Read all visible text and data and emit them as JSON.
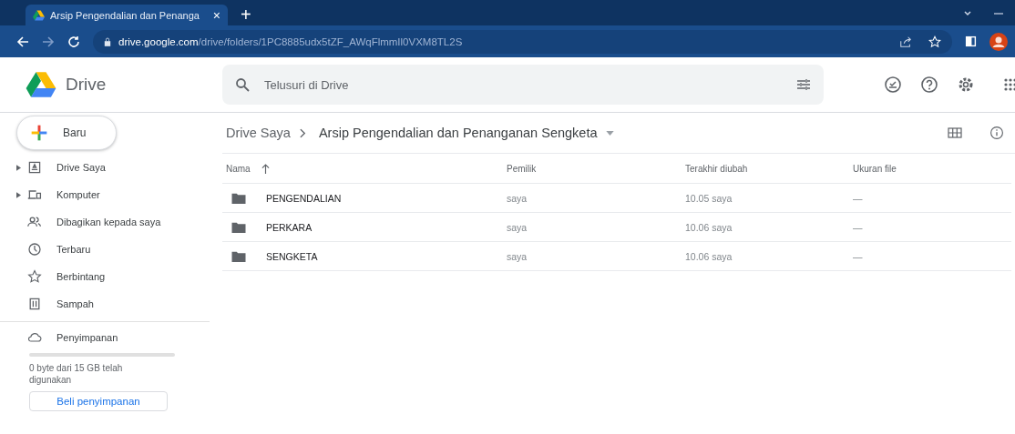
{
  "browser": {
    "tab_title": "Arsip Pengendalian dan Penanga",
    "tab_close": "×",
    "new_tab": "+",
    "url_host": "drive.google.com",
    "url_path": "/drive/folders/1PC8885udx5tZF_AWqFlmmIl0VXM8TL2S"
  },
  "app": {
    "name": "Drive",
    "search": {
      "placeholder": "Telusuri di Drive"
    }
  },
  "new_button": "Baru",
  "sidebar": {
    "items": [
      {
        "kind": "drive",
        "label": "Drive Saya",
        "expandable": true
      },
      {
        "kind": "computer",
        "label": "Komputer",
        "expandable": true
      },
      {
        "kind": "shared",
        "label": "Dibagikan kepada saya",
        "expandable": false
      },
      {
        "kind": "recent",
        "label": "Terbaru",
        "expandable": false
      },
      {
        "kind": "starred",
        "label": "Berbintang",
        "expandable": false
      },
      {
        "kind": "trash",
        "label": "Sampah",
        "expandable": false
      }
    ],
    "storage": {
      "label": "Penyimpanan",
      "level": 0,
      "usage": "0 byte dari 15 GB telah digunakan",
      "buy": "Beli penyimpanan"
    }
  },
  "breadcrumb": [
    "Drive Saya",
    "Arsip Pengendalian dan Penanganan Sengketa"
  ],
  "table": {
    "columns": [
      "Nama",
      "Pemilik",
      "Terakhir diubah",
      "Ukuran file"
    ],
    "rows": [
      {
        "name": "PENGENDALIAN",
        "owner": "saya",
        "modified": "10.05 saya",
        "size": "—"
      },
      {
        "name": "PERKARA",
        "owner": "saya",
        "modified": "10.06 saya",
        "size": "—"
      },
      {
        "name": "SENGKETA",
        "owner": "saya",
        "modified": "10.06 saya",
        "size": "—"
      }
    ]
  }
}
